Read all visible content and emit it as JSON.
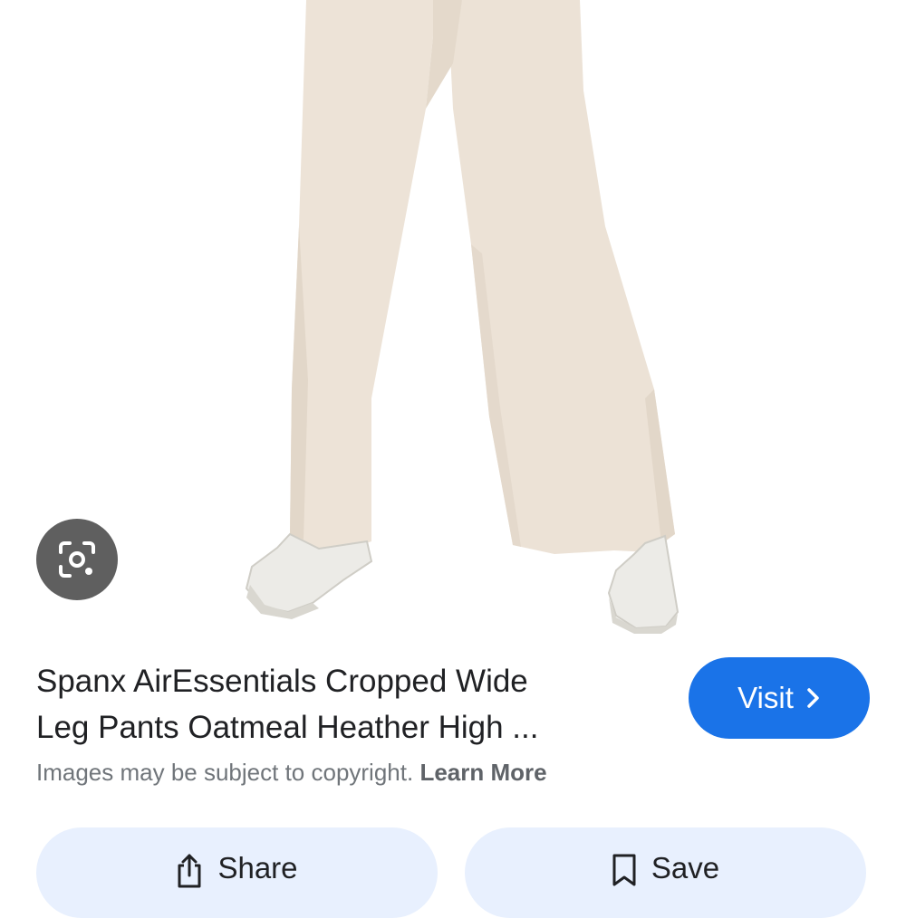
{
  "image": {
    "subject": "wide-leg-pants",
    "colors": {
      "pants": "#ece2d6",
      "shoes": "#ececea",
      "background": "#ffffff"
    }
  },
  "lens": {
    "icon": "google-lens-icon"
  },
  "result": {
    "title_line1": "Spanx AirEssentials Cropped Wide",
    "title_line2": "Leg Pants Oatmeal Heather High ...",
    "copyright_text": "Images may be subject to copyright. ",
    "learn_more": "Learn More"
  },
  "visit": {
    "label": "Visit",
    "icon": "chevron-right-icon",
    "color": "#1a73e8"
  },
  "actions": {
    "share": {
      "label": "Share",
      "icon": "share-icon"
    },
    "save": {
      "label": "Save",
      "icon": "bookmark-icon"
    }
  }
}
